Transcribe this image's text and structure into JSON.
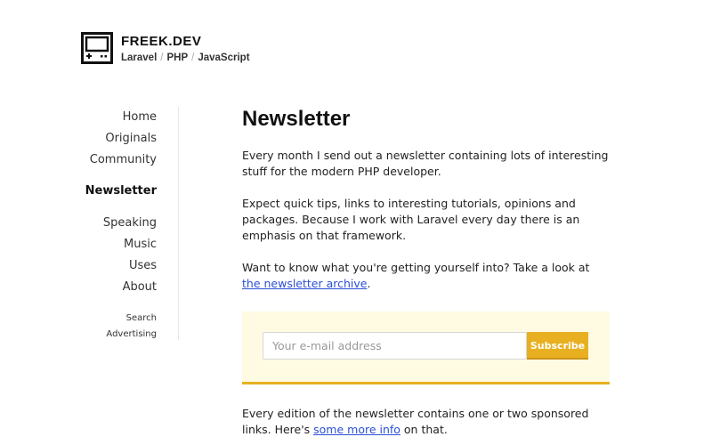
{
  "brand": {
    "title": "FREEK.DEV",
    "tags": [
      "Laravel",
      "PHP",
      "JavaScript"
    ],
    "separator": "/"
  },
  "nav": {
    "items": [
      "Home",
      "Originals",
      "Community",
      "Newsletter",
      "Speaking",
      "Music",
      "Uses",
      "About"
    ],
    "active": "Newsletter",
    "small_items": [
      "Search",
      "Advertising"
    ]
  },
  "main": {
    "title": "Newsletter",
    "p1": "Every month I send out a newsletter containing lots of interesting stuff for the modern PHP developer.",
    "p2": "Expect quick tips, links to interesting tutorials, opinions and packages. Because I work with Laravel every day there is an emphasis on that framework.",
    "p3_prefix": "Want to know what you're getting yourself into? Take a look at ",
    "p3_link": "the newsletter archive",
    "p3_suffix": ".",
    "p4_prefix": "Every edition of the newsletter contains one or two sponsored links. Here's ",
    "p4_link": "some more info",
    "p4_suffix": " on that."
  },
  "form": {
    "email_placeholder": "Your e-mail address",
    "button": "Subscribe"
  },
  "colors": {
    "accent": "#e8b020",
    "form_bg": "#fffbe3",
    "link": "#2a4fd6"
  }
}
